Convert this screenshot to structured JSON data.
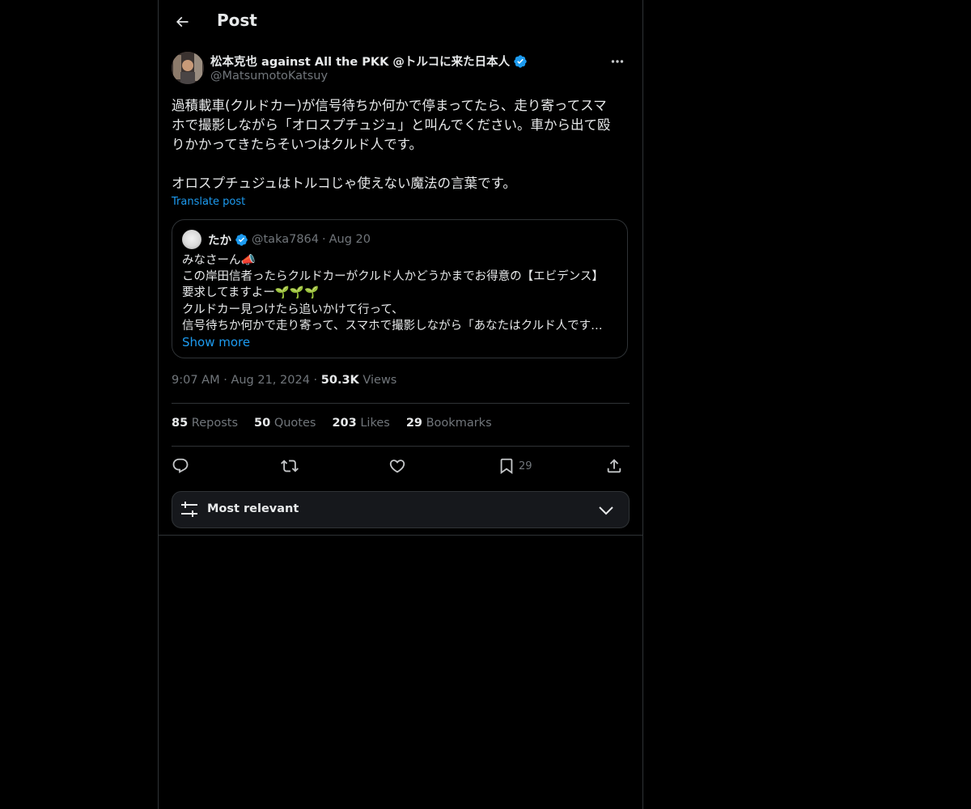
{
  "header": {
    "title": "Post"
  },
  "post": {
    "display_name": "松本克也 against All the PKK @トルコに来た日本人",
    "handle": "@MatsumotoKatsuy",
    "text": "過積載車(クルドカー)が信号待ちか何かで停まってたら、走り寄ってスマ\nホで撮影しながら「オロスプチュジュ」と叫んでください。車から出て殴\nりかかってきたらそいつはクルド人です。\n\nオロスプチュジュはトルコじゃ使えない魔法の言葉です。",
    "translate_label": "Translate post"
  },
  "quote": {
    "display_name": "たか",
    "handle": "@taka7864",
    "separator": "·",
    "date": "Aug 20",
    "lines": [
      "みなさーん📣",
      "この岸田信者ったらクルドカーがクルド人かどうかまでお得意の【エビデンス】",
      "要求してますよー🌱🌱🌱",
      "クルドカー見つけたら追いかけて行って、",
      "信号待ちか何かで走り寄って、スマホで撮影しながら「あなたはクルド人です…"
    ],
    "show_more": "Show more"
  },
  "meta": {
    "time": "9:07 AM",
    "sep": "·",
    "date": "Aug 21, 2024",
    "views_count": "50.3K",
    "views_label": "Views"
  },
  "stats": [
    {
      "count": "85",
      "label": "Reposts"
    },
    {
      "count": "50",
      "label": "Quotes"
    },
    {
      "count": "203",
      "label": "Likes"
    },
    {
      "count": "29",
      "label": "Bookmarks"
    }
  ],
  "actions": {
    "icons": [
      "reply-icon",
      "repost-icon",
      "like-icon",
      "bookmark-icon",
      "share-icon"
    ],
    "bookmark_count": "29"
  },
  "sort": {
    "label": "Most relevant"
  },
  "colors": {
    "background": "#000000",
    "text": "#e7e9ea",
    "muted": "#71767b",
    "accent": "#1d9bf0",
    "border": "#2f3336",
    "verified": "#1d9bf0"
  }
}
